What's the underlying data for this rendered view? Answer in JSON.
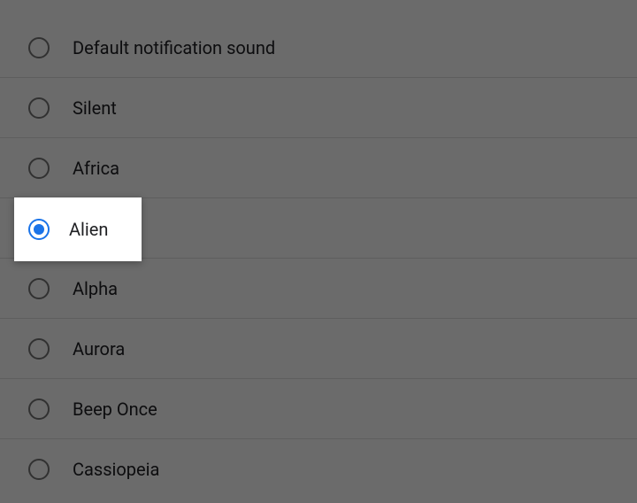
{
  "sounds": {
    "items": [
      {
        "label": "Default notification sound",
        "selected": false
      },
      {
        "label": "Silent",
        "selected": false
      },
      {
        "label": "Africa",
        "selected": false
      },
      {
        "label": "Alien",
        "selected": true
      },
      {
        "label": "Alpha",
        "selected": false
      },
      {
        "label": "Aurora",
        "selected": false
      },
      {
        "label": "Beep Once",
        "selected": false
      },
      {
        "label": "Cassiopeia",
        "selected": false
      }
    ]
  },
  "highlight": {
    "label": "Alien"
  }
}
